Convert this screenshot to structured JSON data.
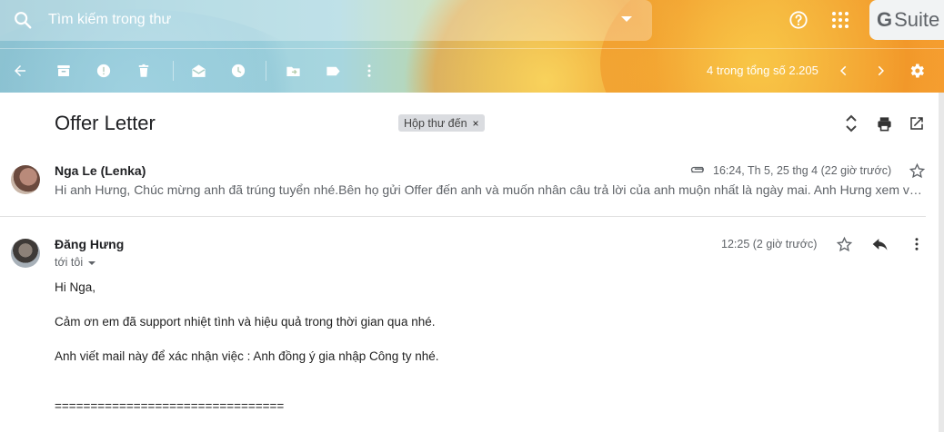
{
  "header": {
    "search_placeholder": "Tìm kiếm trong thư",
    "gsuite_g": "G",
    "gsuite_text": "Suite"
  },
  "toolbar": {
    "count_text": "4 trong tổng số 2.205"
  },
  "email": {
    "subject": "Offer Letter",
    "label": "Hộp thư đến",
    "label_close": "×",
    "messages": [
      {
        "sender": "Nga Le (Lenka)",
        "time": "16:24, Th 5, 25 thg 4 (22 giờ trước)",
        "snippet": "Hi anh Hưng, Chúc mừng anh đã trúng tuyển          nhé.Bên họ gửi Offer đến anh và muốn nhân câu trả lời của anh muộn nhất là ngày mai. Anh Hưng xem và …"
      },
      {
        "sender": "Đăng Hưng",
        "to": "tới tôi",
        "time": "12:25 (2 giờ trước)",
        "body": [
          "Hi Nga,",
          "Cảm ơn em đã support nhiệt tình và hiệu quả trong thời gian qua nhé.",
          "Anh viết mail này để xác nhận việc : Anh đồng ý gia nhập Công ty                       nhé.",
          "================================"
        ]
      }
    ]
  }
}
